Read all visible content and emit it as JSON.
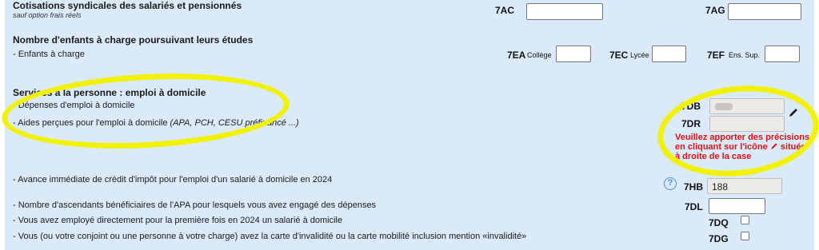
{
  "cotisations": {
    "title": "Cotisations syndicales des salariés et pensionnés",
    "subtitle": "sauf option frais réels",
    "code_7ac": "7AC",
    "code_7ag": "7AG"
  },
  "enfants": {
    "title": "Nombre d'enfants à charge poursuivant leurs études",
    "row_label": "- Enfants à charge",
    "code_7ea": "7EA",
    "label_7ea": "Collège",
    "code_7ec": "7EC",
    "label_7ec": "Lycée",
    "code_7ef": "7EF",
    "label_7ef": "Ens. Sup."
  },
  "services": {
    "title": "Services à la personne : emploi à domicile",
    "depenses_label": "- Dépenses d'emploi à domicile",
    "aides_label": "- Aides perçues pour l'emploi à domicile ",
    "aides_examples": "(APA, PCH, CESU préfinancé ...)",
    "code_7db": "7DB",
    "code_7dr": "7DR",
    "note_before_icon": "Veuillez apporter des précisions en cliquant sur l'icône",
    "note_after_icon": " située à droite de la case",
    "avance_label": "- Avance immédiate de crédit d'impôt pour l'emploi d'un salarié à domicile en 2024",
    "code_7hb": "7HB",
    "value_7hb": "188",
    "ascendants_label": "- Nombre d'ascendants bénéficiaires de l'APA pour lesquels vous avez engagé des dépenses",
    "code_7dl": "7DL",
    "premiere_fois_label": "- Vous avez employé directement pour la première fois en 2024 un salarié à domicile",
    "code_7dq": "7DQ",
    "invalidite_label": "- Vous (ou votre conjoint ou une personne à votre charge) avez la carte d'invalidité ou la carte mobilité inclusion mention «invalidité»",
    "code_7dg": "7DG"
  },
  "icons": {
    "edit": "pencil-icon",
    "help": "help-icon"
  },
  "colors": {
    "background": "#dbeafa",
    "highlight": "#f0f200",
    "note": "#e01010"
  }
}
